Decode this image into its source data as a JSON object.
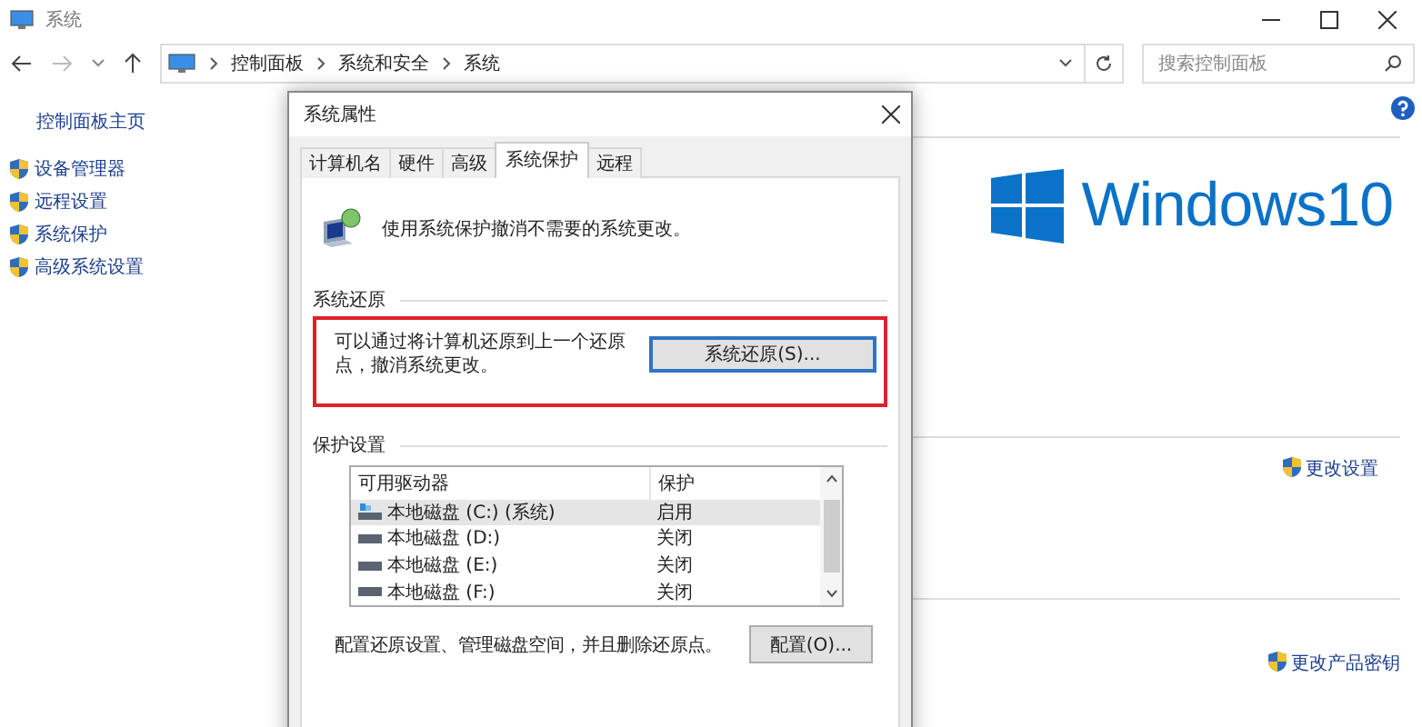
{
  "window": {
    "title": "系统"
  },
  "address_bar": {
    "path": [
      "控制面板",
      "系统和安全",
      "系统"
    ]
  },
  "search": {
    "placeholder": "搜索控制面板"
  },
  "sidebar": {
    "home_link": "控制面板主页",
    "items": [
      {
        "label": "设备管理器"
      },
      {
        "label": "远程设置"
      },
      {
        "label": "系统保护"
      },
      {
        "label": "高级系统设置"
      }
    ]
  },
  "main": {
    "logo_text": "Windows10",
    "links": [
      {
        "label": "更改设置"
      },
      {
        "label": "更改产品密钥"
      }
    ]
  },
  "dialog": {
    "title": "系统属性",
    "tabs": [
      {
        "label": "计算机名",
        "selected": false
      },
      {
        "label": "硬件",
        "selected": false
      },
      {
        "label": "高级",
        "selected": false
      },
      {
        "label": "系统保护",
        "selected": true
      },
      {
        "label": "远程",
        "selected": false
      }
    ],
    "intro": "使用系统保护撤消不需要的系统更改。",
    "restore_group": {
      "title": "系统还原",
      "highlighted": true,
      "text": "可以通过将计算机还原到上一个还原点，撤消系统更改。",
      "button": "系统还原(S)..."
    },
    "protection_group": {
      "title": "保护设置",
      "columns": [
        "可用驱动器",
        "保护"
      ],
      "drives": [
        {
          "name": "本地磁盘 (C:) (系统)",
          "protection": "启用",
          "system": true,
          "selected": true
        },
        {
          "name": "本地磁盘 (D:)",
          "protection": "关闭",
          "system": false,
          "selected": false
        },
        {
          "name": "本地磁盘 (E:)",
          "protection": "关闭",
          "system": false,
          "selected": false
        },
        {
          "name": "本地磁盘 (F:)",
          "protection": "关闭",
          "system": false,
          "selected": false
        }
      ],
      "config_text": "配置还原设置、管理磁盘空间，并且删除还原点。",
      "config_button": "配置(O)..."
    }
  }
}
